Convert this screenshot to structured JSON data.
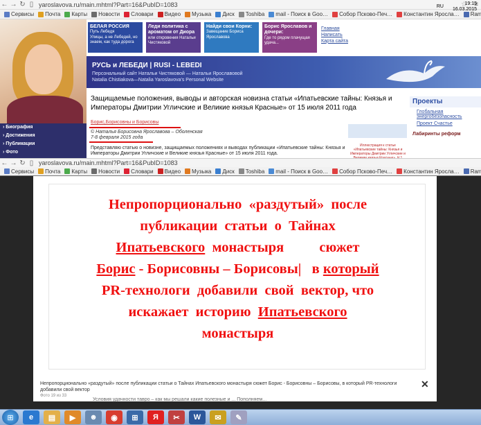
{
  "browser": {
    "url": "yaroslavova.ru/main.mhtml?Part=16&PubID=1083",
    "bookmarks": [
      {
        "label": "Сервисы",
        "color": "#5a7cc5"
      },
      {
        "label": "Почта",
        "color": "#e0a020"
      },
      {
        "label": "Карты",
        "color": "#4caa4c"
      },
      {
        "label": "Новости",
        "color": "#6b6b6b"
      },
      {
        "label": "Словари",
        "color": "#d23"
      },
      {
        "label": "Видео",
        "color": "#c22"
      },
      {
        "label": "Музыка",
        "color": "#e07a20"
      },
      {
        "label": "Диск",
        "color": "#3a7fd0"
      },
      {
        "label": "Toshiba",
        "color": "#888"
      },
      {
        "label": "mail - Поиск в Goo…",
        "color": "#4a8ad4"
      },
      {
        "label": "Собор Псково-Печ…",
        "color": "#e04040"
      },
      {
        "label": "Константин Яросла…",
        "color": "#e04040"
      },
      {
        "label": "Rambler.ru",
        "color": "#4a6ab0"
      }
    ],
    "bookmarks2": [
      {
        "label": "Сервисы",
        "color": "#5a7cc5"
      },
      {
        "label": "Почта",
        "color": "#e0a020"
      },
      {
        "label": "Карты",
        "color": "#4caa4c"
      },
      {
        "label": "Новости",
        "color": "#6b6b6b"
      },
      {
        "label": "Словари",
        "color": "#d23"
      },
      {
        "label": "Видео",
        "color": "#c22"
      },
      {
        "label": "Музыка",
        "color": "#e07a20"
      },
      {
        "label": "Диск",
        "color": "#3a7fd0"
      },
      {
        "label": "Toshiba",
        "color": "#888"
      },
      {
        "label": "mail - Поиск в Goo…",
        "color": "#4a8ad4"
      },
      {
        "label": "Собор Псково-Печ…",
        "color": "#e04040"
      },
      {
        "label": "Константин Яросла…",
        "color": "#e04040"
      },
      {
        "label": "Rambler.ru",
        "color": "#4a6ab0"
      }
    ]
  },
  "site": {
    "promos": [
      {
        "title": "БЕЛАЯ РОССИЯ",
        "sub": "Путь Лебедя",
        "text": "Улицы, а не Лебедей, но знаем, как туда дорога",
        "color": "#2b4aa0"
      },
      {
        "title": "Леди политика с ароматом от Диора",
        "sub": "",
        "text": "или откровения Натальи Чистяковой",
        "color": "#5a3d8e"
      },
      {
        "title": "Найди свои Корни:",
        "sub": "",
        "text": "Завещание Бориса Ярославова",
        "color": "#2f7ac0"
      },
      {
        "title": "Борис Ярославов и дочери:",
        "sub": "",
        "text": "Где то рядом плачущая удача...",
        "color": "#8a3f86"
      }
    ],
    "top_links": [
      "Главная",
      "Написать",
      "Карта сайта"
    ],
    "banner_title": "РУСЬ и ЛЕБЕДИ | RUSI - LEBEDI",
    "banner_sub1": "Персональный сайт Натальи Чистяковой — Натальи Ярославовой",
    "banner_sub2": "Natalia Chistiakova—Natalia Yaroslavova's Personal Website",
    "left_nav": [
      "Биография",
      "Достижения",
      "Публикации",
      "Фото"
    ],
    "headline": "Защищаемые положения, выводы и авторская новизна статьи «Ипатьевские тайны: Князья и Императоры Дмитрии Угличские и Великие князья Красные» от 15 июля 2011 года",
    "tag": "Борис,Борисовны и Борисовы",
    "copyright": "© Наталья Борисовна Ярославова – Оболенская",
    "date": "7-8 февраля 2015 года",
    "paragraph": "Представляю статью о новизне, защищаемых положениях и выводах публикации «Ипатьевские тайны: Князья и Императоры Дмитрии Угличские и Великие князья Красные» от 15 июля 2011 года.",
    "side_caption": "Иллюстрация к статье «Ипатьевские тайны: Князья и Императоры Дмитрии Угличские и Великие князья Красные», Ч.1",
    "right_heading": "Проекты",
    "right_items": [
      "Глобальная энергобезопасность",
      "Проект Счастье"
    ],
    "right_footer": "Лабиринты реформ"
  },
  "lightbox": {
    "lines": [
      [
        {
          "t": "Непропорционально  «раздутый»  после",
          "u": false
        }
      ],
      [
        {
          "t": "публикации  статьи  о  Тайнах",
          "u": false
        }
      ],
      [
        {
          "t": "Ипатьевского",
          "u": true
        },
        {
          "t": "  монастыря          сюжет",
          "u": false
        }
      ],
      [
        {
          "t": "Борис",
          "u": true
        },
        {
          "t": " - Борисовны – Борисовы|   в ",
          "u": false
        },
        {
          "t": "который",
          "u": true
        }
      ],
      [
        {
          "t": "PR-технологи  добавили  свой  вектор, что",
          "u": false
        }
      ],
      [
        {
          "t": "искажает  историю  ",
          "u": false
        },
        {
          "t": "Ипатьевского",
          "u": true
        }
      ],
      [
        {
          "t": "монастыря",
          "u": false
        }
      ]
    ],
    "caption": "Непропорционально «раздутый» после публикации статьи о Тайнах Ипатьевского монастыря сюжет Борис - Борисовны – Борисовы, в который PR-технологи добавили свой вектор",
    "counter": "Фото 19 из 33",
    "close_glyph": "✕",
    "below_text": "Условия удачности тавро – как мы решали какие полезные и ... Пополняем…"
  },
  "taskbar": {
    "apps": [
      {
        "name": "ie-icon",
        "glyph": "e",
        "color": "#2a79d0"
      },
      {
        "name": "folder-icon",
        "glyph": "▤",
        "color": "#e3b04a"
      },
      {
        "name": "media-icon",
        "glyph": "▶",
        "color": "#e08a2a"
      },
      {
        "name": "user-icon",
        "glyph": "☻",
        "color": "#6a8ab0"
      },
      {
        "name": "chrome-icon",
        "glyph": "◉",
        "color": "#d83d2f"
      },
      {
        "name": "network-icon",
        "glyph": "⊞",
        "color": "#3a6aa8"
      },
      {
        "name": "yandex-icon",
        "glyph": "Я",
        "color": "#e02020"
      },
      {
        "name": "tool-icon",
        "glyph": "✂",
        "color": "#c04040"
      },
      {
        "name": "word-icon",
        "glyph": "W",
        "color": "#2b579a"
      },
      {
        "name": "mail-icon",
        "glyph": "✉",
        "color": "#c9a020"
      },
      {
        "name": "paint-icon",
        "glyph": "✎",
        "color": "#a0a0c0"
      }
    ],
    "lang": "RU",
    "time": "19:15",
    "date": "16.03.2015"
  }
}
